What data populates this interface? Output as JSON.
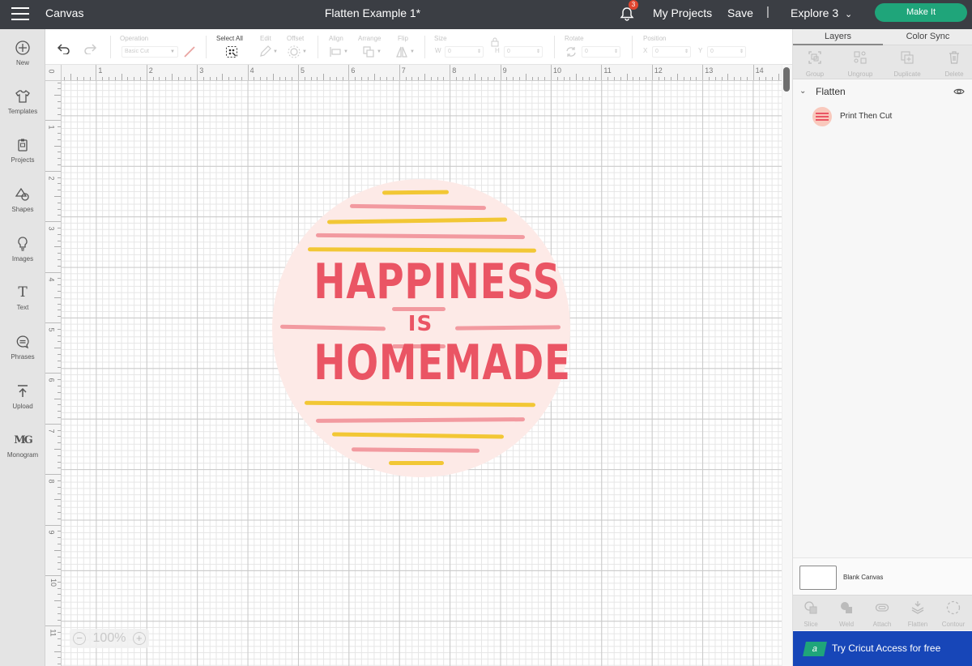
{
  "topbar": {
    "app_title": "Canvas",
    "document_title": "Flatten Example 1*",
    "notification_count": "3",
    "my_projects_label": "My Projects",
    "save_label": "Save",
    "separator": "|",
    "machine_label": "Explore 3",
    "make_it_label": "Make It",
    "colors": {
      "bar": "#3b3e44",
      "make_it": "#1fa57a",
      "badge": "#e0452f"
    }
  },
  "leftnav": {
    "items": [
      {
        "label": "New",
        "icon": "plus-circle-icon"
      },
      {
        "label": "Templates",
        "icon": "shirt-icon"
      },
      {
        "label": "Projects",
        "icon": "clipboard-icon"
      },
      {
        "label": "Shapes",
        "icon": "shapes-icon"
      },
      {
        "label": "Images",
        "icon": "lightbulb-icon"
      },
      {
        "label": "Text",
        "icon": "text-icon"
      },
      {
        "label": "Phrases",
        "icon": "speech-bubble-icon"
      },
      {
        "label": "Upload",
        "icon": "upload-icon"
      },
      {
        "label": "Monogram",
        "icon": "monogram-icon"
      }
    ]
  },
  "toolbar": {
    "operation_label": "Operation",
    "operation_value": "Basic Cut",
    "select_all_label": "Select All",
    "edit_label": "Edit",
    "offset_label": "Offset",
    "align_label": "Align",
    "arrange_label": "Arrange",
    "flip_label": "Flip",
    "size_label": "Size",
    "width_letter": "W",
    "width_value": "0",
    "height_letter": "H",
    "height_value": "0",
    "rotate_label": "Rotate",
    "rotate_value": "0",
    "position_label": "Position",
    "x_letter": "X",
    "x_value": "0",
    "y_letter": "Y",
    "y_value": "0"
  },
  "canvas": {
    "ruler_unit": "inches",
    "horizontal_ruler_labels": [
      "0",
      "1",
      "2",
      "3",
      "4",
      "5",
      "6",
      "7",
      "8",
      "9",
      "10",
      "11",
      "12",
      "13",
      "14"
    ],
    "vertical_ruler_labels": [
      "1",
      "2",
      "3",
      "4",
      "5",
      "6",
      "7",
      "8",
      "9",
      "10",
      "11"
    ],
    "zoom_level": "100%",
    "design": {
      "line1": "HAPPINESS",
      "line2": "IS",
      "line3": "HOMEMADE",
      "colors": {
        "background": "#fdeae7",
        "text": "#ea5564",
        "yellow_stripe": "#f2c735",
        "pink_stripe": "#f29aa0"
      }
    }
  },
  "rightpanel": {
    "tabs": [
      {
        "label": "Layers",
        "active": true
      },
      {
        "label": "Color Sync",
        "active": false
      }
    ],
    "actions": [
      {
        "label": "Group",
        "icon": "group-icon"
      },
      {
        "label": "Ungroup",
        "icon": "ungroup-icon"
      },
      {
        "label": "Duplicate",
        "icon": "duplicate-icon"
      },
      {
        "label": "Delete",
        "icon": "trash-icon"
      }
    ],
    "layer_group": {
      "name": "Flatten",
      "expanded": true,
      "visible": true
    },
    "layer_items": [
      {
        "name": "Print Then Cut"
      }
    ],
    "blank_canvas_label": "Blank Canvas",
    "bottom_actions": [
      {
        "label": "Slice",
        "icon": "slice-icon"
      },
      {
        "label": "Weld",
        "icon": "weld-icon"
      },
      {
        "label": "Attach",
        "icon": "paperclip-icon"
      },
      {
        "label": "Flatten",
        "icon": "flatten-icon"
      },
      {
        "label": "Contour",
        "icon": "contour-icon"
      }
    ],
    "access_banner": {
      "logo_letter": "a",
      "label": "Try Cricut Access for free",
      "color": "#1746b8"
    }
  }
}
